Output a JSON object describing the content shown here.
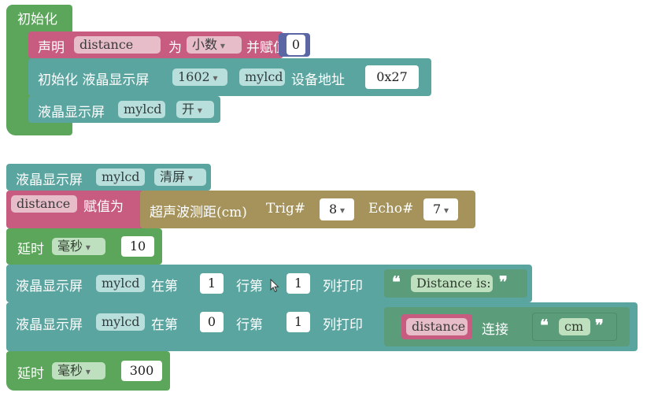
{
  "setup": {
    "title": "初始化",
    "declare": {
      "label": "声明",
      "var_name": "distance",
      "as_label": "为",
      "type": "小数",
      "assign_label": "并赋值",
      "value": "0"
    },
    "lcd_init": {
      "label": "初始化 液晶显示屏",
      "model": "1602",
      "name": "mylcd",
      "addr_label": "设备地址",
      "addr": "0x27"
    },
    "lcd_on": {
      "label": "液晶显示屏",
      "name": "mylcd",
      "state": "开"
    }
  },
  "loop": {
    "clear": {
      "label": "液晶显示屏",
      "name": "mylcd",
      "action": "清屏"
    },
    "assign": {
      "var_name": "distance",
      "label": "赋值为",
      "sensor_label": "超声波测距(cm)",
      "trig_label": "Trig#",
      "trig": "8",
      "echo_label": "Echo#",
      "echo": "7"
    },
    "delay1": {
      "label": "延时",
      "unit": "毫秒",
      "value": "10"
    },
    "print1": {
      "label": "液晶显示屏",
      "name": "mylcd",
      "at_label": "在第",
      "row": "1",
      "row_label": "行第",
      "col": "1",
      "col_label": "列打印",
      "text": "Distance is:"
    },
    "print2": {
      "label": "液晶显示屏",
      "name": "mylcd",
      "at_label": "在第",
      "row": "0",
      "row_label": "行第",
      "col": "1",
      "col_label": "列打印",
      "var_name": "distance",
      "concat_label": "连接",
      "text": "cm"
    },
    "delay2": {
      "label": "延时",
      "unit": "毫秒",
      "value": "300"
    }
  },
  "colors": {
    "control": "#5ba65b",
    "lcd": "#5ba5a0",
    "variable": "#c75c80",
    "math": "#5b67a5",
    "sensor": "#a5935b",
    "text": "#5b9c7a"
  }
}
